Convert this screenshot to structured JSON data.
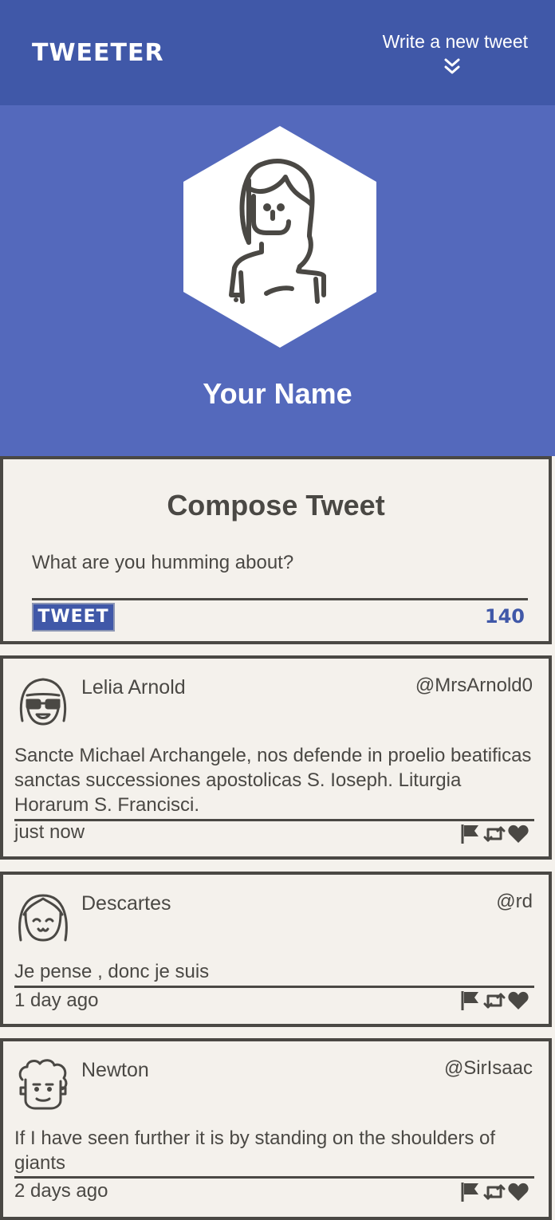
{
  "nav": {
    "logo": "TWEETER",
    "compose_toggle_label": "Write a new tweet"
  },
  "profile": {
    "name": "Your Name"
  },
  "compose": {
    "title": "Compose Tweet",
    "placeholder": "What are you humming about?",
    "tweet_button": "TWEET",
    "char_counter": "140"
  },
  "tweets": [
    {
      "name": "Lelia Arnold",
      "handle": "@MrsArnold0",
      "body": "Sancte Michael Archangele, nos defende in proelio beatificas sanctas successiones apostolicas S. Ioseph. Liturgia Horarum S. Francisci.",
      "time": "just now",
      "avatar_icon": "girl-sunglasses-avatar-icon"
    },
    {
      "name": "Descartes",
      "handle": "@rd",
      "body": "Je pense , donc je suis",
      "time": "1 day ago",
      "avatar_icon": "smiling-bob-hair-avatar-icon"
    },
    {
      "name": "Newton",
      "handle": "@SirIsaac",
      "body": "If I have seen further it is by standing on the shoulders of giants",
      "time": "2 days ago",
      "avatar_icon": "curly-hair-avatar-icon"
    }
  ],
  "colors": {
    "nav_bg": "#4058a8",
    "profile_bg": "#5469bc",
    "card_bg": "#f4f1ec",
    "text": "#4a4844",
    "accent": "#4058a8"
  }
}
